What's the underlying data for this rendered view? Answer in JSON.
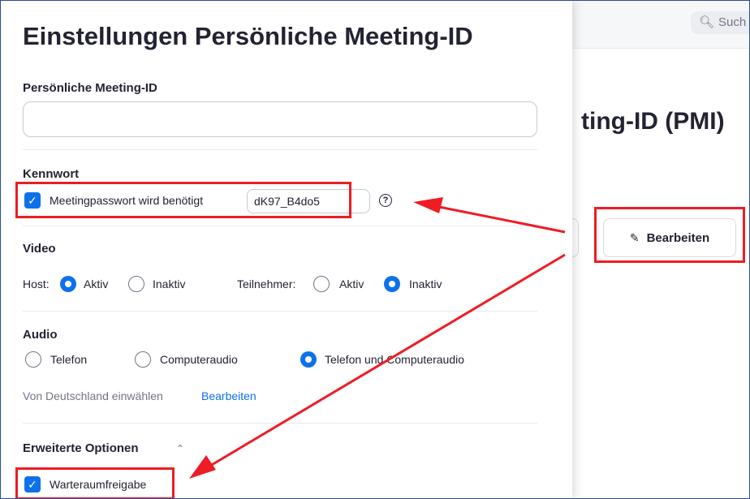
{
  "background": {
    "search_placeholder": "Such",
    "heading_partial": "ting-ID (PMI)",
    "edit_button_label": "Bearbeiten"
  },
  "dialog": {
    "title": "Einstellungen Persönliche Meeting-ID",
    "pmi": {
      "label": "Persönliche Meeting-ID",
      "value": ""
    },
    "password": {
      "section_label": "Kennwort",
      "checkbox_label": "Meetingpasswort wird benötigt",
      "checked": true,
      "value": "dK97_B4do5",
      "help_icon": "question-circle-icon"
    },
    "video": {
      "section_label": "Video",
      "host_label": "Host:",
      "participants_label": "Teilnehmer:",
      "on_label": "Aktiv",
      "off_label": "Inaktiv",
      "host_value": "Aktiv",
      "participants_value": "Inaktiv"
    },
    "audio": {
      "section_label": "Audio",
      "options": [
        "Telefon",
        "Computeraudio",
        "Telefon und Computeraudio"
      ],
      "selected": "Telefon und Computeraudio",
      "dial_in_text": "Von Deutschland einwählen",
      "dial_in_edit": "Bearbeiten"
    },
    "advanced": {
      "section_label": "Erweiterte Optionen",
      "waiting_room_label": "Warteraumfreigabe",
      "waiting_room_checked": true
    }
  },
  "annotation_color": "#ee1c25",
  "accent_color": "#0e71eb"
}
